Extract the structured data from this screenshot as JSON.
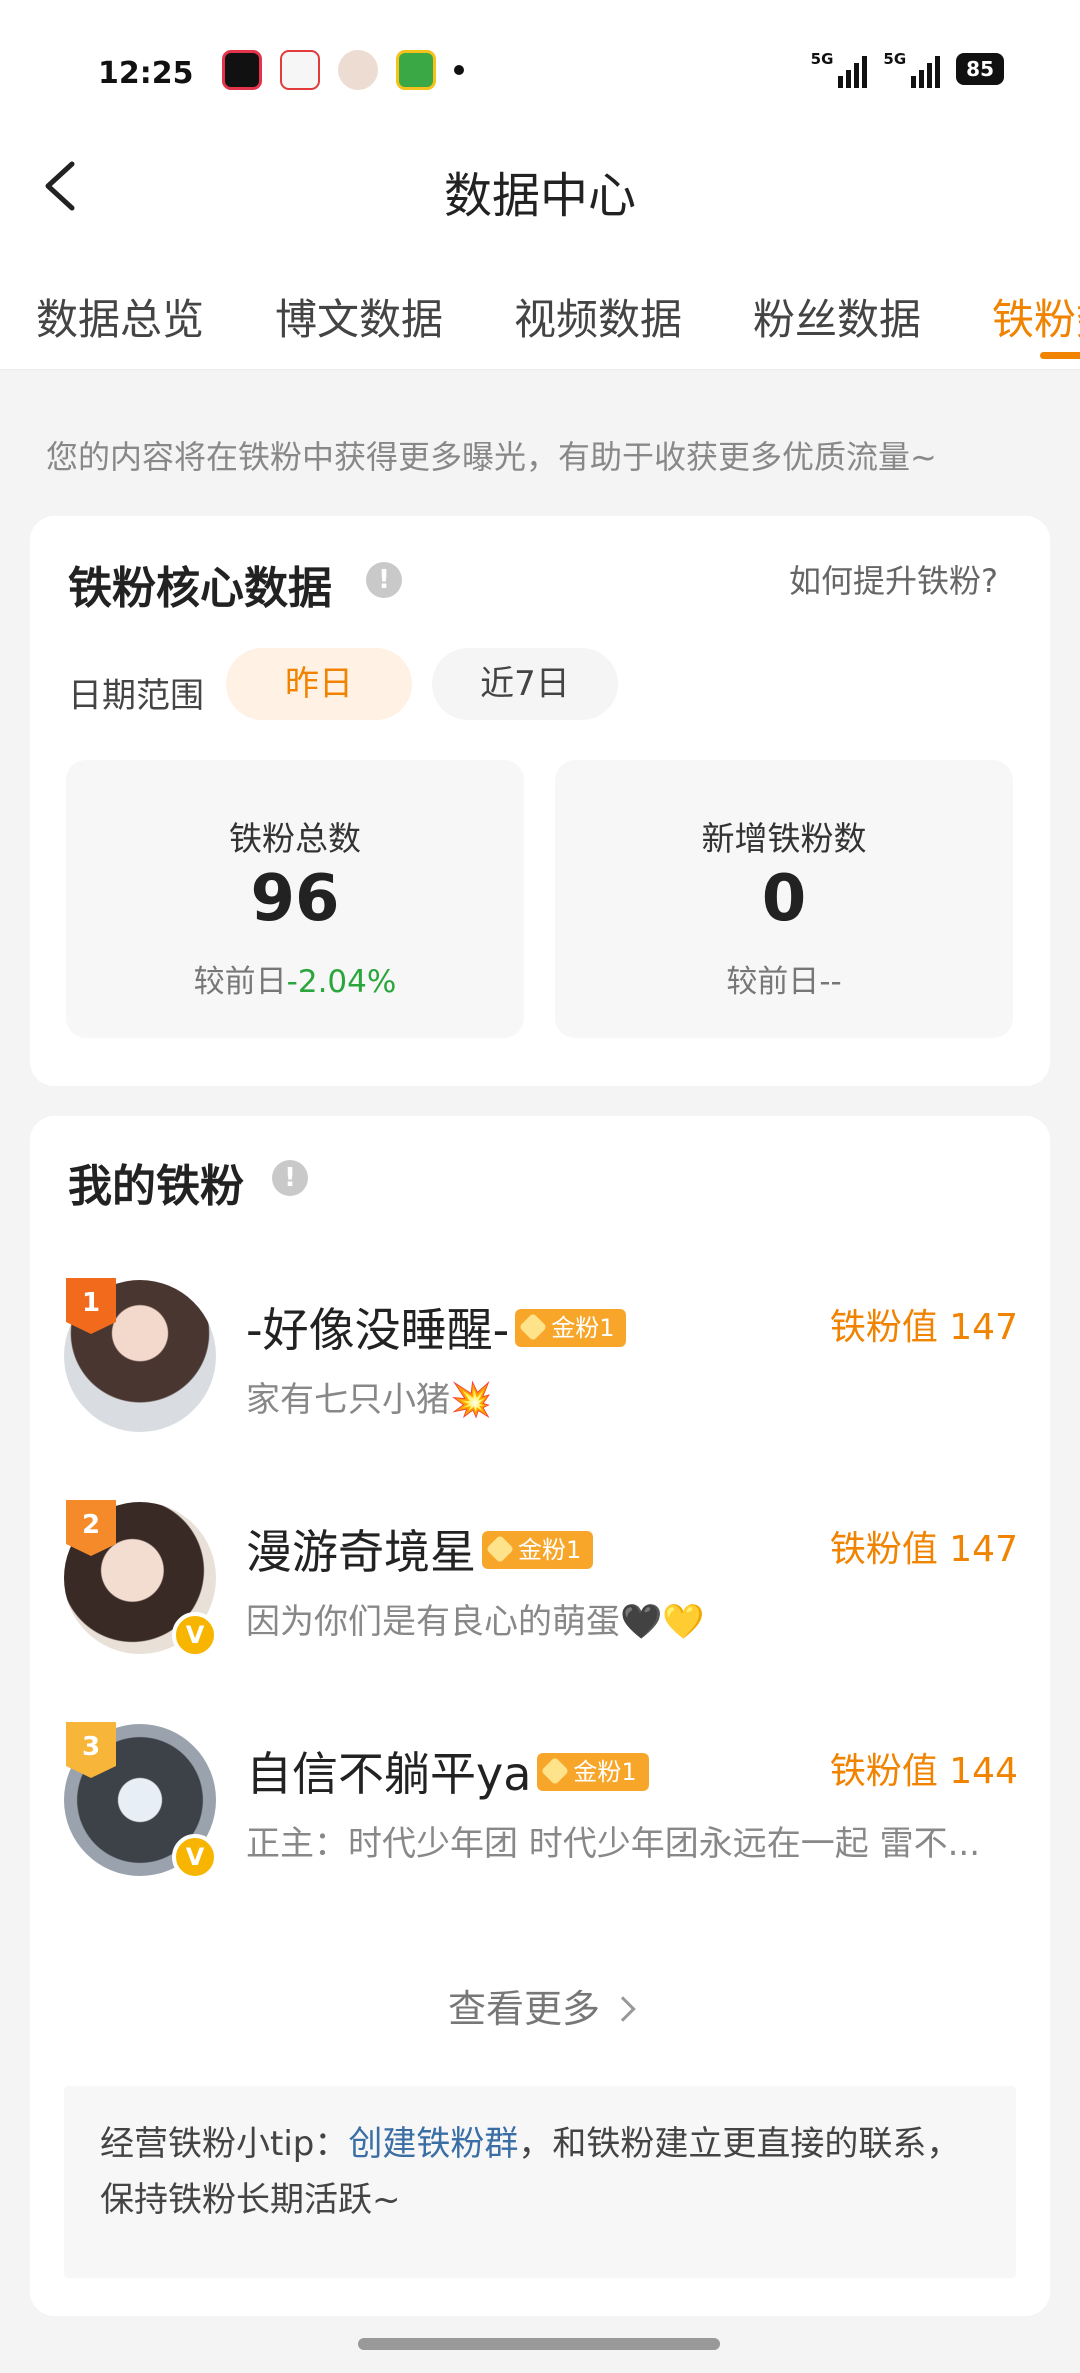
{
  "status_bar": {
    "time": "12:25",
    "network_1": "5G",
    "network_2": "5G",
    "battery": "85"
  },
  "nav": {
    "title": "数据中心"
  },
  "tabs": [
    {
      "label": "数据总览",
      "active": false
    },
    {
      "label": "博文数据",
      "active": false
    },
    {
      "label": "视频数据",
      "active": false
    },
    {
      "label": "粉丝数据",
      "active": false
    },
    {
      "label": "铁粉数据",
      "active": true
    }
  ],
  "tip": "您的内容将在铁粉中获得更多曝光，有助于收获更多优质流量~",
  "core": {
    "title": "铁粉核心数据",
    "help": "如何提升铁粉?",
    "date_label": "日期范围",
    "chips": [
      "昨日",
      "近7日"
    ],
    "stats": [
      {
        "label": "铁粉总数",
        "value": "96",
        "compare_prefix": "较前日",
        "change": "-2.04%"
      },
      {
        "label": "新增铁粉数",
        "value": "0",
        "compare_prefix": "较前日",
        "change": "--"
      }
    ]
  },
  "my_fans": {
    "title": "我的铁粉",
    "fans": [
      {
        "rank": "1",
        "name": "-好像没睡醒-",
        "level": "金粉1",
        "signature": "家有七只小猪💥",
        "value": "铁粉值 147",
        "verified": false
      },
      {
        "rank": "2",
        "name": "漫游奇境星",
        "level": "金粉1",
        "signature": "因为你们是有良心的萌蛋🖤💛",
        "value": "铁粉值 147",
        "verified": true
      },
      {
        "rank": "3",
        "name": "自信不躺平ya",
        "level": "金粉1",
        "signature": "正主：时代少年团 时代少年团永远在一起 雷不...",
        "value": "铁粉值 144",
        "verified": true
      }
    ],
    "more": "查看更多",
    "tip_prefix": "经营铁粉小tip：",
    "tip_link": "创建铁粉群",
    "tip_suffix": "，和铁粉建立更直接的联系，保持铁粉长期活跃~"
  },
  "colors": {
    "accent": "#f08300",
    "link": "#3a6ea5",
    "positive": "#2aa63c"
  }
}
